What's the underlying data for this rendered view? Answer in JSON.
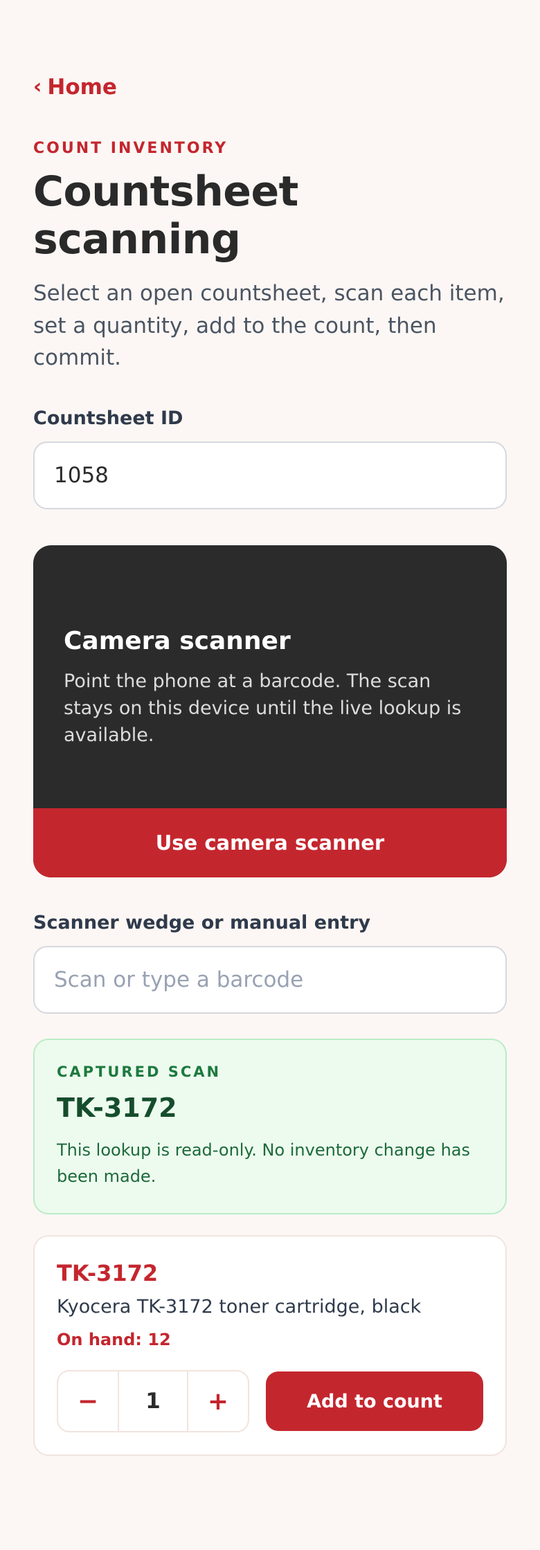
{
  "nav": {
    "back_icon": "chevron-left-icon",
    "back_glyph": "‹",
    "back_label": "Home"
  },
  "header": {
    "eyebrow": "COUNT INVENTORY",
    "title": "Countsheet scanning",
    "intro": "Select an open countsheet, scan each item, set a quantity, add to the count, then commit."
  },
  "countsheet": {
    "label": "Countsheet ID",
    "value": "1058"
  },
  "camera": {
    "title": "Camera scanner",
    "description": "Point the phone at a barcode. The scan stays on this device until the live lookup is available.",
    "button_label": "Use camera scanner"
  },
  "manual_entry": {
    "label": "Scanner wedge or manual entry",
    "placeholder": "Scan or type a barcode",
    "value": ""
  },
  "captured_scan": {
    "eyebrow": "CAPTURED SCAN",
    "code": "TK-3172",
    "note": "This lookup is read-only. No inventory change has been made."
  },
  "product": {
    "code": "TK-3172",
    "name": "Kyocera TK-3172 toner cartridge, black",
    "on_hand": "On hand: 12",
    "quantity": "1",
    "decrement_glyph": "−",
    "increment_glyph": "+",
    "add_label": "Add to count"
  },
  "colors": {
    "accent": "#c4262e",
    "background": "#fcf7f4",
    "camera_panel": "#2b2b2b",
    "success_bg": "#edfbef",
    "success_text": "#1d7a3e"
  }
}
